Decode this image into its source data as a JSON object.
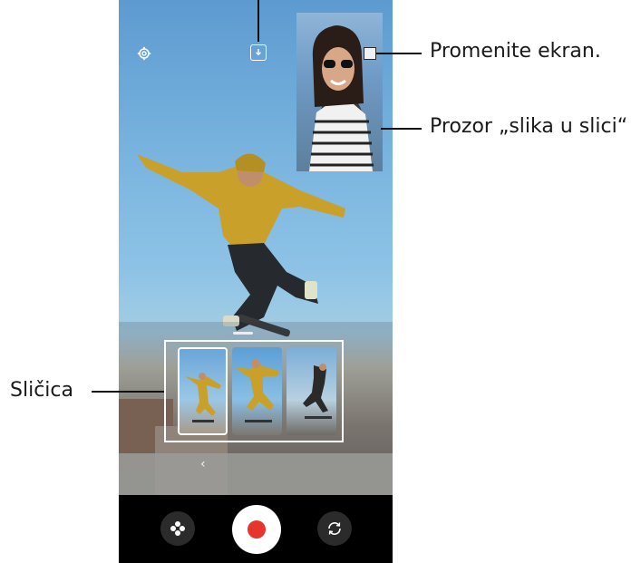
{
  "viewfinder": {
    "settings_icon": "gear-icon",
    "download_icon": "download-icon",
    "more_icon": "chevron-left-icon",
    "more_glyph": "‹"
  },
  "pip_window": {
    "switch_icon": "switch-screen-icon"
  },
  "thumbnails": [
    {
      "name": "thumbnail-1"
    },
    {
      "name": "thumbnail-2"
    },
    {
      "name": "thumbnail-3"
    }
  ],
  "controls": {
    "effects_icon": "flower-icon",
    "record_icon": "record-icon",
    "flip_icon": "flip-camera-icon"
  },
  "annotations": {
    "switch_screen": "Promenite ekran.",
    "pip_window": "Prozor „slika u slici“",
    "thumbnail": "Sličica"
  },
  "colors": {
    "record": "#e5352d",
    "control_bar": "#000000",
    "annotation_line": "#111111"
  }
}
